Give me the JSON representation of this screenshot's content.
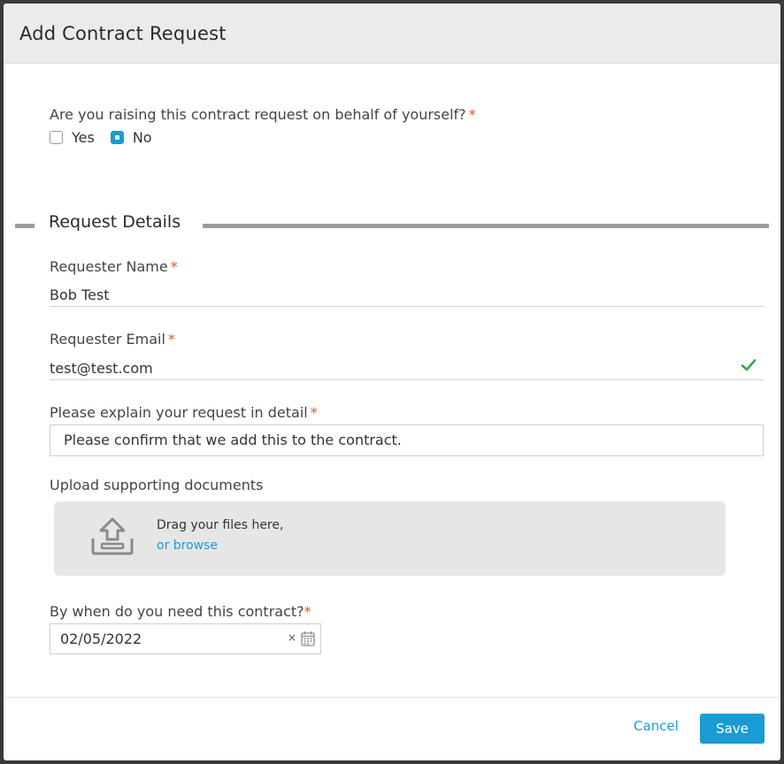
{
  "modal": {
    "title": "Add Contract Request"
  },
  "question": {
    "label": "Are you raising this contract request on behalf of yourself?",
    "required_mark": "*",
    "options": [
      {
        "label": "Yes",
        "checked": false
      },
      {
        "label": "No",
        "checked": true
      }
    ]
  },
  "section": {
    "title": "Request Details"
  },
  "fields": {
    "requester_name": {
      "label": "Requester Name",
      "required_mark": "*",
      "value": "Bob Test"
    },
    "requester_email": {
      "label": "Requester Email",
      "required_mark": "*",
      "value": "test@test.com",
      "valid_icon": "check-icon"
    },
    "request_detail": {
      "label": "Please explain your request in detail",
      "required_mark": "*",
      "value": "Please confirm that we add this to the contract."
    },
    "upload": {
      "label": "Upload supporting documents",
      "drop_text": "Drag your files here,",
      "browse_text": "or browse",
      "icon": "upload-tray-icon"
    },
    "due_date": {
      "label": "By when do you need this contract?",
      "required_mark": "*",
      "value": "02/05/2022",
      "clear_symbol": "×",
      "icon": "calendar-icon"
    }
  },
  "footer": {
    "cancel_label": "Cancel",
    "save_label": "Save"
  },
  "colors": {
    "accent": "#1a9bd4",
    "required": "#e5532d",
    "valid": "#3aa845"
  }
}
